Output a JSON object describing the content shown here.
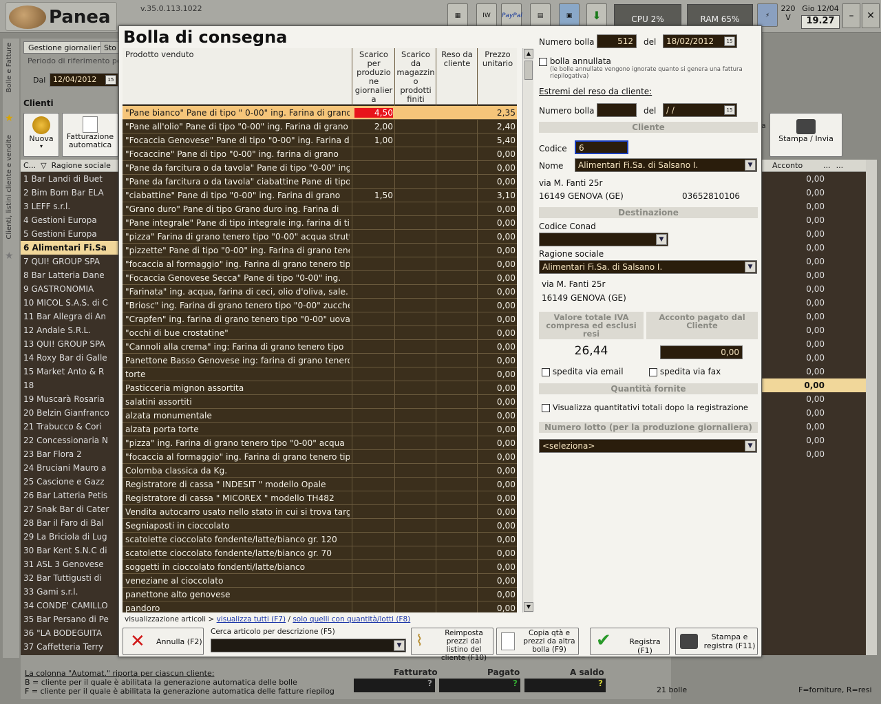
{
  "app": {
    "name": "Panea",
    "version": "v.35.0.113.1022",
    "cpu": "CPU 2%",
    "ram": "RAM 65%",
    "volt_value": "220",
    "volt_unit": "V",
    "date": "Gio 12/04",
    "time": "19.27",
    "paypal": "PayPal"
  },
  "rail": {
    "top": "Bolle e Fatture",
    "bottom": "Clienti, listini cliente e vendite"
  },
  "bg": {
    "tab1": "Gestione giornaliera",
    "tab2": "Sto",
    "period": "Periodo di riferimento pe",
    "dal": "Dal",
    "dal_date": "12/04/2012",
    "clienti": "Clienti",
    "nuova": "Nuova",
    "fatturazione": "Fatturazione automatica",
    "col_c": "C...",
    "col_rag": "Ragione sociale",
    "col_acc": "Acconto",
    "stampa": "Stampa / Invia",
    "clients": [
      "1 Bar Landi di Buet",
      "2 Bim Bom Bar ELA",
      "3 LEFF s.r.l.",
      "4 Gestioni Europa",
      "5 Gestioni Europa",
      "6 Alimentari Fi.Sa",
      "7 QUI! GROUP SPA",
      "8 Bar Latteria Dane",
      "9 GASTRONOMIA",
      "10 MICOL S.A.S. di C",
      "11 Bar Allegra di An",
      "12 Andale S.R.L.",
      "13 QUI! GROUP SPA",
      "14 Roxy Bar di Galle",
      "15 Market Anto & R",
      "18",
      "19 Muscarà Rosaria",
      "20 Belzin Gianfranco",
      "21 Trabucco & Cori",
      "22 Concessionaria N",
      "23 Bar Flora 2",
      "24 Bruciani Mauro a",
      "25 Cascione e Gazz",
      "26 Bar Latteria Petis",
      "27 Snak Bar di Cater",
      "28 Bar  il Faro di Bal",
      "29 La Briciola di Lug",
      "30 Bar Kent S.N.C di",
      "31 ASL 3 Genovese",
      "32 Bar Tuttigusti di",
      "33 Gami s.r.l.",
      "34 CONDE' CAMILLO",
      "35 Bar Persano di Pe",
      "36 \"LA BODEGUITA",
      "37 Caffetteria Terry"
    ],
    "acconti": [
      "0,00",
      "0,00",
      "0,00",
      "0,00",
      "0,00",
      "0,00",
      "0,00",
      "0,00",
      "0,00",
      "0,00",
      "0,00",
      "0,00",
      "0,00",
      "0,00",
      "0,00",
      "0,00",
      "0,00",
      "0,00",
      "0,00",
      "0,00",
      "0,00"
    ],
    "footer_note": "La colonna \"Automat.\" riporta per ciascun cliente:",
    "footer_b": "B = cliente per il quale è abilitata la generazione automatica delle bolle",
    "footer_f": "F = cliente per il quale è abilitata la generazione automatica delle fatture riepilog",
    "fatturato": "Fatturato",
    "pagato": "Pagato",
    "a_saldo": "A saldo",
    "q": "?",
    "bolle_count": "21 bolle",
    "legend": "F=forniture, R=resi"
  },
  "dialog": {
    "title": "Bolla di consegna",
    "headers": {
      "prodotto": "Prodotto venduto",
      "scarico_prod": "Scarico per produzio ne giornalier a",
      "scarico_mag": "Scarico da magazzin o prodotti finiti",
      "reso": "Reso da cliente",
      "prezzo": "Prezzo unitario"
    },
    "rows": [
      [
        "\"Pane bianco\"  Pane di tipo \" 0-00\"  ing. Farina di grano",
        "4,50",
        "2,35"
      ],
      [
        "\"Pane all'olio\"  Pane di tipo \"0-00\" ing. Farina di grano",
        "2,00",
        "2,40"
      ],
      [
        "\"Focaccia Genovese\" Pane di tipo \"0-00\" ing. Farina di",
        "1,00",
        "5,40"
      ],
      [
        "\"Focaccine\" Pane di tipo \"0-00\" ing. farina di grano",
        "",
        "0,00"
      ],
      [
        "\"Pane da farcitura o da tavola\" Pane di tipo \"0-00\" ing.",
        "",
        "0,00"
      ],
      [
        "\"Pane da farcitura o da tavola\" ciabattine  Pane di tipo",
        "",
        "0,00"
      ],
      [
        "\"ciabattine\" Pane di tipo \"0-00\" ing. Farina di grano",
        "1,50",
        "3,10"
      ],
      [
        "\"Grano duro\" Pane di tipo Grano duro ing. Farina di",
        "",
        "0,00"
      ],
      [
        "\"Pane integrale\" Pane di tipo integrale ing. farina di tipo",
        "",
        "0,00"
      ],
      [
        "\"pizza\"   Farina di grano tenero tipo \"0-00\" acqua strutto,",
        "",
        "0,00"
      ],
      [
        "\"pizzette\" Pane di tipo \"0-00\" ing. Farina di grano tenero",
        "",
        "0,00"
      ],
      [
        "\"focaccia al formaggio\"  ing. Farina di grano tenero tipo",
        "",
        "0,00"
      ],
      [
        "\"Focaccia Genovese Secca\" Pane di tipo \"0-00\" ing.",
        "",
        "0,00"
      ],
      [
        "\"Farinata\" ing. acqua, farina di ceci, olio d'oliva,  sale.",
        "",
        "0,00"
      ],
      [
        "\"Briosc\" ing. Farina di grano tenero tipo \"0-00\" zucchero,",
        "",
        "0,00"
      ],
      [
        "\"Crapfen\" ing. farina di grano tenero tipo \"0-00\"  uova",
        "",
        "0,00"
      ],
      [
        "\"occhi di bue crostatine\"",
        "",
        "0,00"
      ],
      [
        "\"Cannoli alla crema\" ing: Farina di grano tenero tipo",
        "",
        "0,00"
      ],
      [
        "Panettone Basso Genovese  ing: farina di grano tenero",
        "",
        "0,00"
      ],
      [
        "torte",
        "",
        "0,00"
      ],
      [
        "Pasticceria mignon assortita",
        "",
        "0,00"
      ],
      [
        "salatini assortiti",
        "",
        "0,00"
      ],
      [
        "alzata monumentale",
        "",
        "0,00"
      ],
      [
        "alzata porta torte",
        "",
        "0,00"
      ],
      [
        "\"pizza\"  ing. Farina di grano tenero tipo \"0-00\" acqua",
        "",
        "0,00"
      ],
      [
        "\"focaccia al formaggio\"  ing. Farina di grano tenero tipo",
        "",
        "0,00"
      ],
      [
        "Colomba classica da Kg.",
        "",
        "0,00"
      ],
      [
        " Registratore di cassa \" INDESIT \" modello Opale",
        "",
        "0,00"
      ],
      [
        " Registratore di cassa \" MICOREX \" modello TH482",
        "",
        "0,00"
      ],
      [
        "Vendita autocarro usato nello stato in cui si trova targato",
        "",
        "0,00"
      ],
      [
        "Segniaposti in cioccolato",
        "",
        "0,00"
      ],
      [
        "scatolette cioccolato fondente/latte/bianco gr. 120",
        "",
        "0,00"
      ],
      [
        "scatolette cioccolato fondente/latte/bianco gr. 70",
        "",
        "0,00"
      ],
      [
        "soggetti in cioccolato fondenti/latte/bianco",
        "",
        "0,00"
      ],
      [
        "veneziane al cioccolato",
        "",
        "0,00"
      ],
      [
        "panettone alto genovese",
        "",
        "0,00"
      ],
      [
        "pandoro",
        "",
        "0,00"
      ]
    ],
    "vis_label": "visualizzazione articoli >",
    "vis_all": "visualizza tutti (F7)",
    "vis_sep": "/",
    "vis_only": "solo quelli con quantità/lotti (F8)",
    "btn_annulla": "Annulla (F2)",
    "search_label": "Cerca articolo per descrizione (F5)",
    "btn_reimposta": "Reimposta prezzi dal listino del cliente (F10)",
    "btn_copia": "Copia qtà e prezzi da altra bolla (F9)",
    "btn_registra": "Registra (F1)",
    "btn_stampa": "Stampa e registra (F11)",
    "numero_bolla_label": "Numero bolla",
    "numero_bolla": "512",
    "del_label": "del",
    "del_date": "18/02/2012",
    "annullata": "bolla annullata",
    "annullata_note": "(le bolle annullate vengono ignorate quanto si genera una fattura riepilogativa)",
    "estremi": "Estremi del reso da cliente:",
    "reso_numero_label": "Numero bolla",
    "reso_del_label": "del",
    "reso_date": " / /",
    "cliente_section": "Cliente",
    "codice_label": "Codice",
    "codice": "6",
    "nome_label": "Nome",
    "nome": "Alimentari Fi.Sa. di Salsano I.",
    "addr1": "via M. Fanti 25r",
    "addr2": "16149 GENOVA (GE)",
    "phone": "03652810106",
    "dest_section": "Destinazione",
    "conad_label": "Codice Conad",
    "ragione_label": "Ragione sociale",
    "ragione": "Alimentari Fi.Sa. di Salsano I.",
    "dest_addr1": "via M. Fanti 25r",
    "dest_addr2": "16149 GENOVA (GE)",
    "valore_label": "Valore totale IVA compresa ed esclusi resi",
    "valore": "26,44",
    "acconto_label": "Acconto pagato dal Cliente",
    "acconto": "0,00",
    "email": "spedita via email",
    "fax": "spedita via fax",
    "qta_section": "Quantità fornite",
    "qta_cb": "Visualizza quantitativi totali dopo la registrazione",
    "lotto_section": "Numero lotto (per la produzione giornaliera)",
    "lotto": "<seleziona>"
  }
}
